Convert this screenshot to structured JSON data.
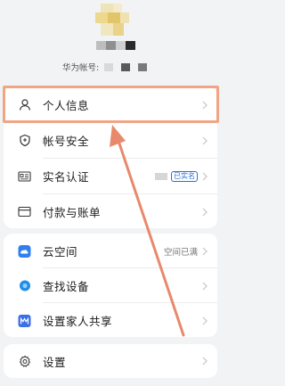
{
  "profile": {
    "account_label": "华为帐号:"
  },
  "menu_group_1": [
    {
      "key": "personal",
      "label": "个人信息",
      "icon": "person-icon"
    },
    {
      "key": "security",
      "label": "帐号安全",
      "icon": "shield-icon"
    },
    {
      "key": "realname",
      "label": "实名认证",
      "icon": "id-card-icon",
      "badge": "已实名"
    },
    {
      "key": "payment",
      "label": "付款与账单",
      "icon": "credit-card-icon"
    }
  ],
  "menu_group_2": [
    {
      "key": "cloud",
      "label": "云空间",
      "icon": "cloud-icon",
      "value": "空间已满"
    },
    {
      "key": "find",
      "label": "查找设备",
      "icon": "find-device-icon"
    },
    {
      "key": "family",
      "label": "设置家人共享",
      "icon": "family-share-icon"
    }
  ],
  "menu_group_3": [
    {
      "key": "settings",
      "label": "设置",
      "icon": "gear-icon"
    }
  ],
  "colors": {
    "highlight": "#f0a585",
    "arrow": "#e8896b",
    "badge": "#2b6fd6",
    "cloud": "#2f7ff0",
    "find": "#1f8ee8",
    "family": "#3b6fe6"
  }
}
